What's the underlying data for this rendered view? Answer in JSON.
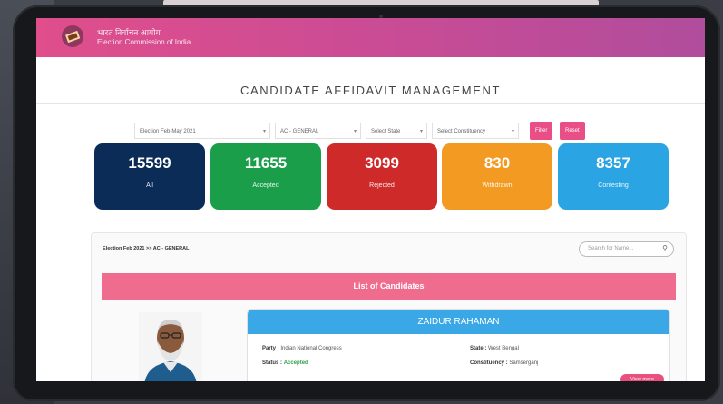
{
  "header": {
    "title_hindi": "भारत निर्वाचन आयोग",
    "title_english": "Election Commission of India"
  },
  "page_title": "CANDIDATE AFFIDAVIT MANAGEMENT",
  "filters": {
    "election": "Election Feb-May 2021",
    "ac": "AC - GENERAL",
    "state": "Select State",
    "constituency": "Select Constituency",
    "filter_button": "Filter",
    "reset_button": "Reset Filter"
  },
  "stats": [
    {
      "value": "15599",
      "label": "All",
      "color": "#0b2c57"
    },
    {
      "value": "11655",
      "label": "Accepted",
      "color": "#1b9e4a"
    },
    {
      "value": "3099",
      "label": "Rejected",
      "color": "#cf2a2a"
    },
    {
      "value": "830",
      "label": "Withdrawn",
      "color": "#f39a23"
    },
    {
      "value": "8357",
      "label": "Contesting",
      "color": "#2aa4e2"
    }
  ],
  "breadcrumb": "Election Feb 2021 >> AC - GENERAL",
  "search_placeholder": "Search for Name...",
  "list_title": "List of Candidates",
  "candidate": {
    "name": "ZAIDUR RAHAMAN",
    "party_label": "Party :",
    "party": "Indian National Congress",
    "state_label": "State :",
    "state": "West Bengal",
    "status_label": "Status :",
    "status": "Accepted",
    "constituency_label": "Constituency :",
    "constituency": "Samserganj",
    "view_button": "View more"
  },
  "colors": {
    "header_gradient_start": "#e04e8c",
    "header_gradient_end": "#b04d9c",
    "accent_pink": "#e94f86",
    "candidate_header": "#3aa8e6"
  }
}
